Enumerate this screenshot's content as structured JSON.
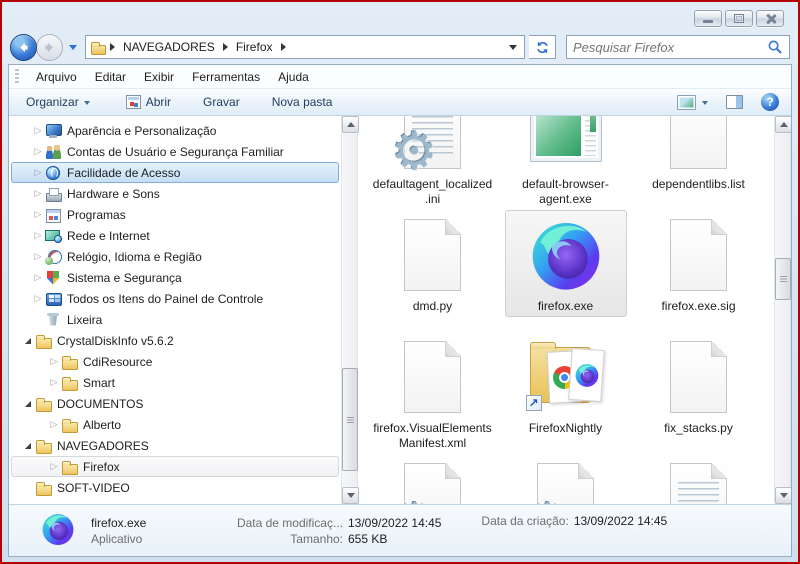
{
  "titlebar": {
    "buttons": [
      "minimize",
      "maximize",
      "close"
    ]
  },
  "navbar": {
    "breadcrumb": [
      "NAVEGADORES",
      "Firefox"
    ],
    "search_placeholder": "Pesquisar Firefox",
    "search_value": ""
  },
  "menubar": {
    "items": [
      "Arquivo",
      "Editar",
      "Exibir",
      "Ferramentas",
      "Ajuda"
    ]
  },
  "toolbar": {
    "organize_label": "Organizar",
    "open_label": "Abrir",
    "burn_label": "Gravar",
    "new_folder_label": "Nova pasta"
  },
  "tree": {
    "items": [
      {
        "label": "Aparência e Personalização",
        "icon": "appearance",
        "level": 1,
        "arrow": "collapsed",
        "state": ""
      },
      {
        "label": "Contas de Usuário e Segurança Familiar",
        "icon": "users",
        "level": 1,
        "arrow": "collapsed",
        "state": ""
      },
      {
        "label": "Facilidade de Acesso",
        "icon": "access",
        "level": 1,
        "arrow": "collapsed",
        "state": "selected"
      },
      {
        "label": "Hardware e Sons",
        "icon": "hardware",
        "level": 1,
        "arrow": "collapsed",
        "state": ""
      },
      {
        "label": "Programas",
        "icon": "programs",
        "level": 1,
        "arrow": "collapsed",
        "state": ""
      },
      {
        "label": "Rede e Internet",
        "icon": "network",
        "level": 1,
        "arrow": "collapsed",
        "state": ""
      },
      {
        "label": "Relógio, Idioma e Região",
        "icon": "clock",
        "level": 1,
        "arrow": "collapsed",
        "state": ""
      },
      {
        "label": "Sistema e Segurança",
        "icon": "system",
        "level": 1,
        "arrow": "collapsed",
        "state": ""
      },
      {
        "label": "Todos os Itens do Painel de Controle",
        "icon": "allitems",
        "level": 1,
        "arrow": "collapsed",
        "state": ""
      },
      {
        "label": "Lixeira",
        "icon": "recycle",
        "level": 1,
        "arrow": "none",
        "state": ""
      },
      {
        "label": "CrystalDiskInfo v5.6.2",
        "icon": "folder",
        "level": 0,
        "arrow": "expanded",
        "state": ""
      },
      {
        "label": "CdiResource",
        "icon": "folder",
        "level": 2,
        "arrow": "collapsed",
        "state": ""
      },
      {
        "label": "Smart",
        "icon": "folder",
        "level": 2,
        "arrow": "collapsed",
        "state": ""
      },
      {
        "label": "DOCUMENTOS",
        "icon": "folder",
        "level": 0,
        "arrow": "expanded",
        "state": ""
      },
      {
        "label": "Alberto",
        "icon": "folder",
        "level": 2,
        "arrow": "collapsed",
        "state": ""
      },
      {
        "label": "NAVEGADORES",
        "icon": "folder",
        "level": 0,
        "arrow": "expanded",
        "state": ""
      },
      {
        "label": "Firefox",
        "icon": "folder",
        "level": 2,
        "arrow": "collapsed",
        "state": "outlined"
      },
      {
        "label": "SOFT-VIDEO",
        "icon": "folder",
        "level": 0,
        "arrow": "none",
        "state": ""
      }
    ]
  },
  "files": {
    "items": [
      {
        "name": "defaultagent_localized.ini",
        "icon": "doc-gear-lines",
        "selected": false
      },
      {
        "name": "default-browser-agent.exe",
        "icon": "exe-window",
        "selected": false
      },
      {
        "name": "dependentlibs.list",
        "icon": "doc-plain",
        "selected": false
      },
      {
        "name": "dmd.py",
        "icon": "doc-plain",
        "selected": false
      },
      {
        "name": "firefox.exe",
        "icon": "firefox-logo",
        "selected": true
      },
      {
        "name": "firefox.exe.sig",
        "icon": "doc-plain",
        "selected": false
      },
      {
        "name": "firefox.VisualElementsManifest.xml",
        "icon": "doc-plain",
        "selected": false
      },
      {
        "name": "FirefoxNightly",
        "icon": "folder-shortcut",
        "selected": false
      },
      {
        "name": "fix_stacks.py",
        "icon": "doc-plain",
        "selected": false
      },
      {
        "name": "",
        "icon": "doc-gear",
        "selected": false
      },
      {
        "name": "",
        "icon": "doc-gear",
        "selected": false
      },
      {
        "name": "",
        "icon": "doc-text",
        "selected": false
      }
    ]
  },
  "details": {
    "name": "firefox.exe",
    "type": "Aplicativo",
    "modified_label": "Data de modificaç...",
    "modified_value": "13/09/2022 14:45",
    "size_label": "Tamanho:",
    "size_value": "655 KB",
    "created_label": "Data da criação:",
    "created_value": "13/09/2022 14:45"
  },
  "colors": {
    "screenshot_border": "#b40000",
    "window_frame": "#d6e4f2",
    "selection_border": "#84acdd",
    "selection_fill": "#cde4f7",
    "toolbar_text": "#1e3c5c"
  }
}
